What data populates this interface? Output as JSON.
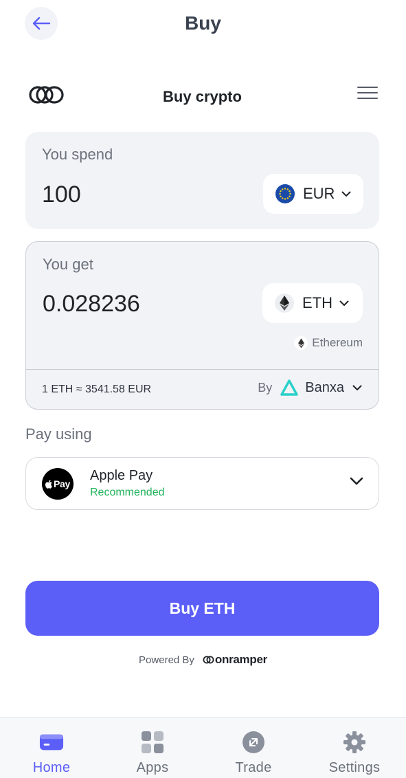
{
  "header": {
    "title": "Buy"
  },
  "widget": {
    "title": "Buy crypto"
  },
  "spend": {
    "label": "You spend",
    "amount": "100",
    "currency": "EUR"
  },
  "get": {
    "label": "You get",
    "amount": "0.028236",
    "currency": "ETH",
    "network": "Ethereum"
  },
  "quote": {
    "rate": "1 ETH ≈ 3541.58 EUR",
    "by_label": "By",
    "provider": "Banxa"
  },
  "payment": {
    "section_label": "Pay using",
    "method": "Apple Pay",
    "badge": "Recommended",
    "icon_text": "Pay"
  },
  "actions": {
    "buy_label": "Buy ETH"
  },
  "footer": {
    "powered_label": "Powered By",
    "brand": "onramper"
  },
  "nav": {
    "items": [
      {
        "label": "Home",
        "icon": "wallet-icon",
        "active": true
      },
      {
        "label": "Apps",
        "icon": "apps-grid-icon",
        "active": false
      },
      {
        "label": "Trade",
        "icon": "trade-arrows-icon",
        "active": false
      },
      {
        "label": "Settings",
        "icon": "gear-icon",
        "active": false
      }
    ]
  },
  "colors": {
    "accent": "#5b5ef7",
    "recommended": "#1fb35a",
    "banxa": "#2ad0c8",
    "eur_flag": "#1b4ba8"
  }
}
